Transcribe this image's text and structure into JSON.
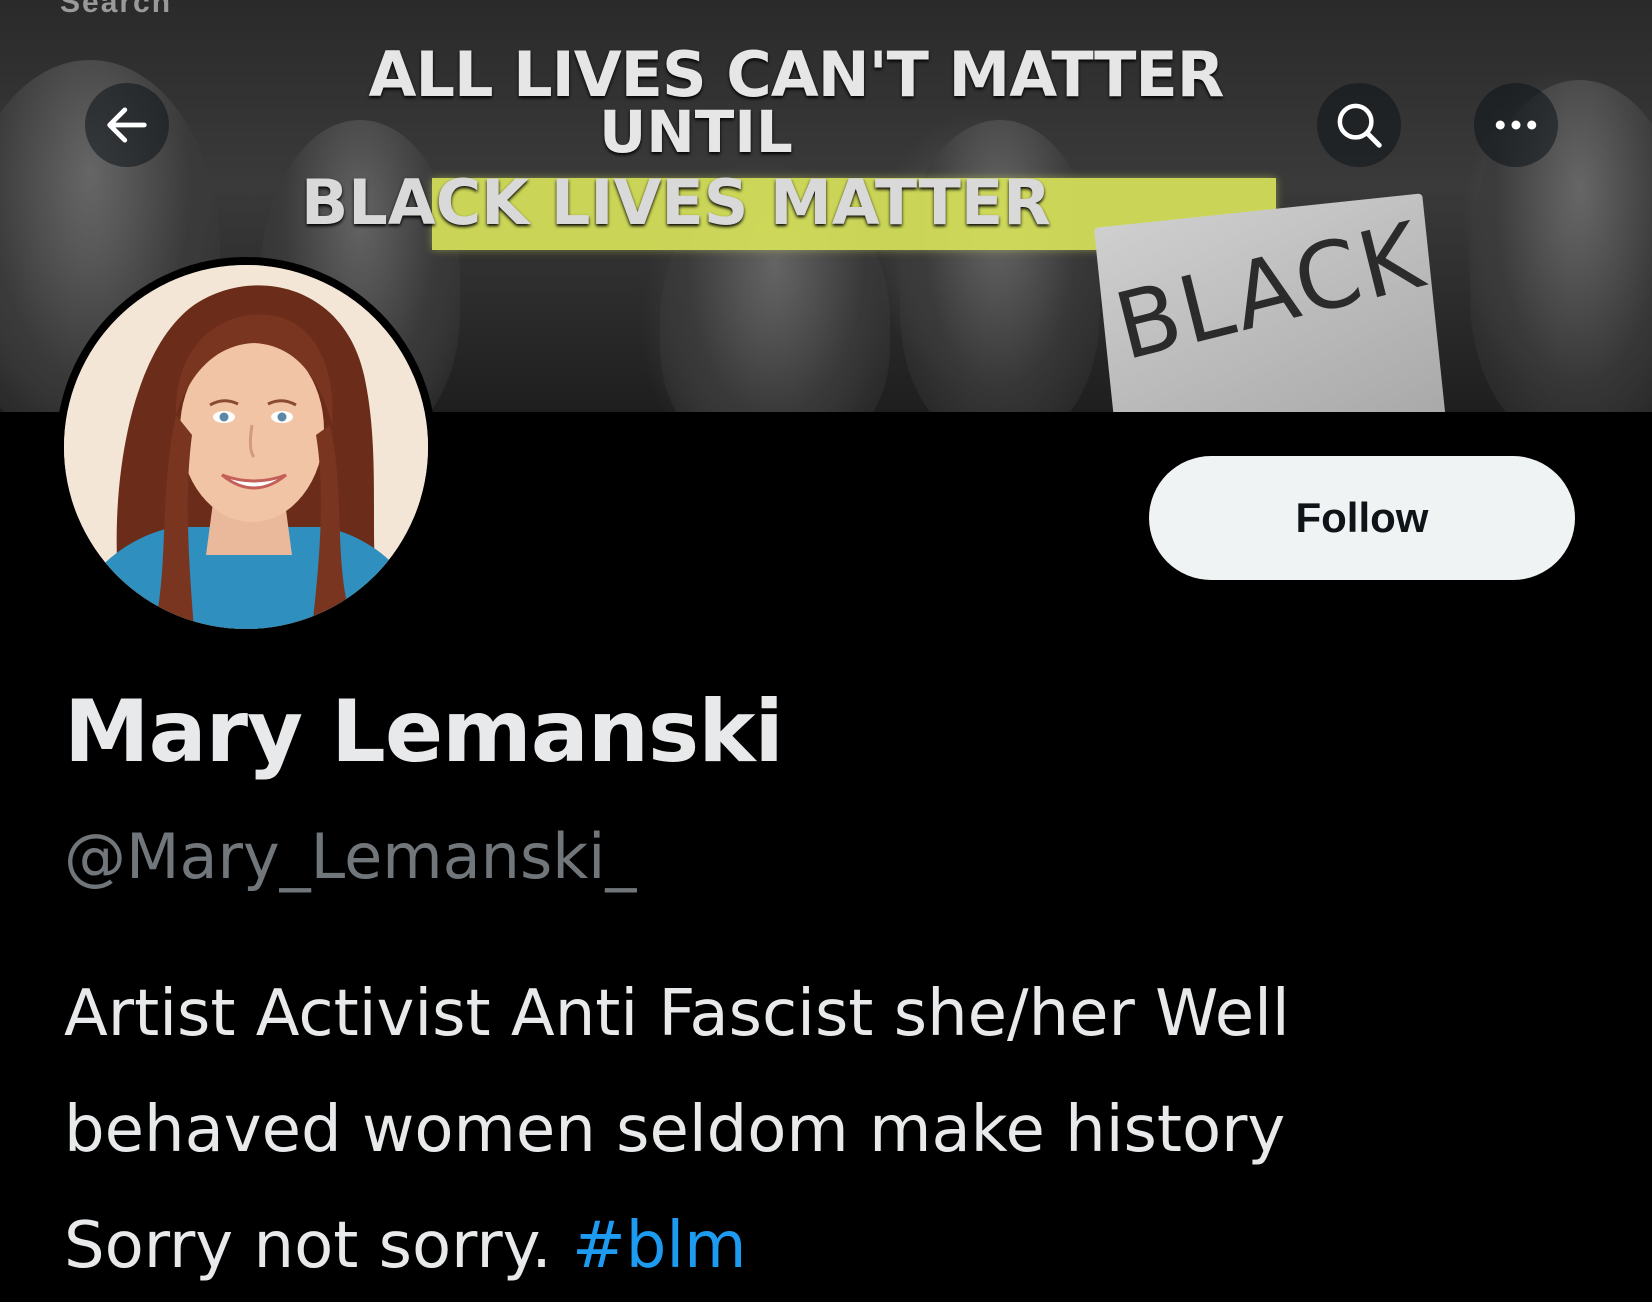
{
  "header": {
    "search_hint": "Search",
    "banner_lines": [
      "ALL LIVES CAN'T MATTER",
      "UNTIL",
      "BLACK LIVES MATTER"
    ],
    "sign_text": "BLACK",
    "back_icon": "arrow-left-icon",
    "search_icon": "search-icon",
    "more_icon": "more-horizontal-icon"
  },
  "profile": {
    "display_name": "Mary Lemanski",
    "handle": "@Mary_Lemanski_",
    "follow_label": "Follow",
    "bio_lines": [
      "Artist Activist Anti Fascist she/her Well",
      "behaved women seldom make history",
      "Sorry not sorry."
    ],
    "bio_hashtag": "#blm"
  },
  "colors": {
    "background": "#000000",
    "text_primary": "#e7e9ea",
    "text_secondary": "#71767b",
    "link": "#1d9bf0",
    "follow_bg": "#eff3f4",
    "banner_highlight": "#d7e35a"
  }
}
